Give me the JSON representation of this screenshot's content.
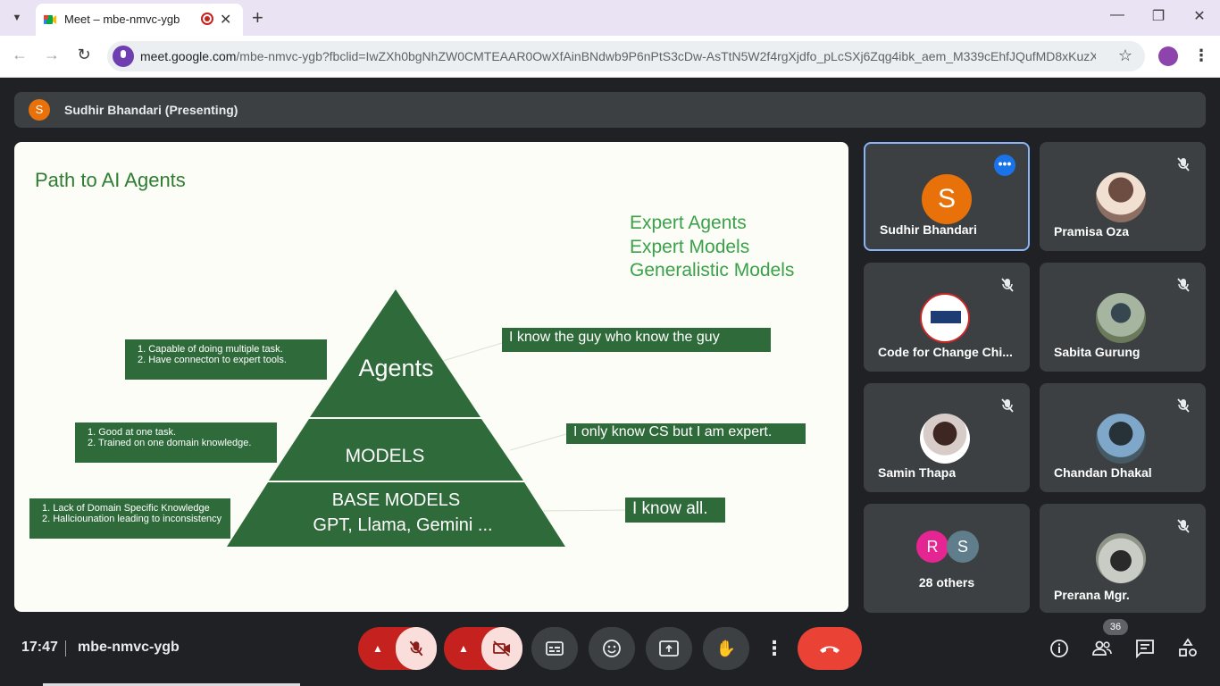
{
  "browser": {
    "tab_title": "Meet – mbe-nmvc-ygb",
    "url_host": "meet.google.com",
    "url_path": "/mbe-nmvc-ygb?fbclid=IwZXh0bgNhZW0CMTEAAR0OwXfAinBNdwb9P6nPtS3cDw-AsTtN5W2f4rgXjdfo_pLcSXj6Zqg4ibk_aem_M339cEhfJQufMD8xKuzXug"
  },
  "presenter_bar": {
    "initial": "S",
    "label": "Sudhir Bhandari (Presenting)"
  },
  "slide": {
    "title": "Path to AI Agents",
    "legend": [
      "Expert Agents",
      "Expert Models",
      "Generalistic Models"
    ],
    "pyramid": {
      "top": "Agents",
      "middle": "MODELS",
      "base_line1": "BASE MODELS",
      "base_line2": "GPT, Llama, Gemini ..."
    },
    "notes": {
      "agents": [
        "1. Capable of doing multiple task.",
        "2. Have connecton to expert tools."
      ],
      "models": [
        "1. Good at one task.",
        "2. Trained on one domain knowledge."
      ],
      "base": [
        "1. Lack of Domain Specific Knowledge",
        "2. Hallciounation leading to inconsistency"
      ]
    },
    "quotes": {
      "agents": "I know the guy who know the guy",
      "models": "I only know CS but I am expert.",
      "base": "I know all."
    }
  },
  "participants": [
    {
      "name": "Sudhir Bhandari",
      "initial": "S",
      "color": "#e8710a",
      "muted": false,
      "active": true
    },
    {
      "name": "Pramisa Oza",
      "muted": true
    },
    {
      "name": "Code for Change Chi...",
      "muted": true
    },
    {
      "name": "Sabita Gurung",
      "muted": true
    },
    {
      "name": "Samin Thapa",
      "muted": true
    },
    {
      "name": "Chandan Dhakal",
      "muted": true
    },
    {
      "name": "28 others",
      "initials": [
        "R",
        "S"
      ],
      "colors": [
        "#e52592",
        "#607d8b"
      ]
    },
    {
      "name": "Prerana Mgr.",
      "muted": true
    }
  ],
  "meeting": {
    "time": "17:47",
    "code": "mbe-nmvc-ygb",
    "participant_count": "36"
  }
}
